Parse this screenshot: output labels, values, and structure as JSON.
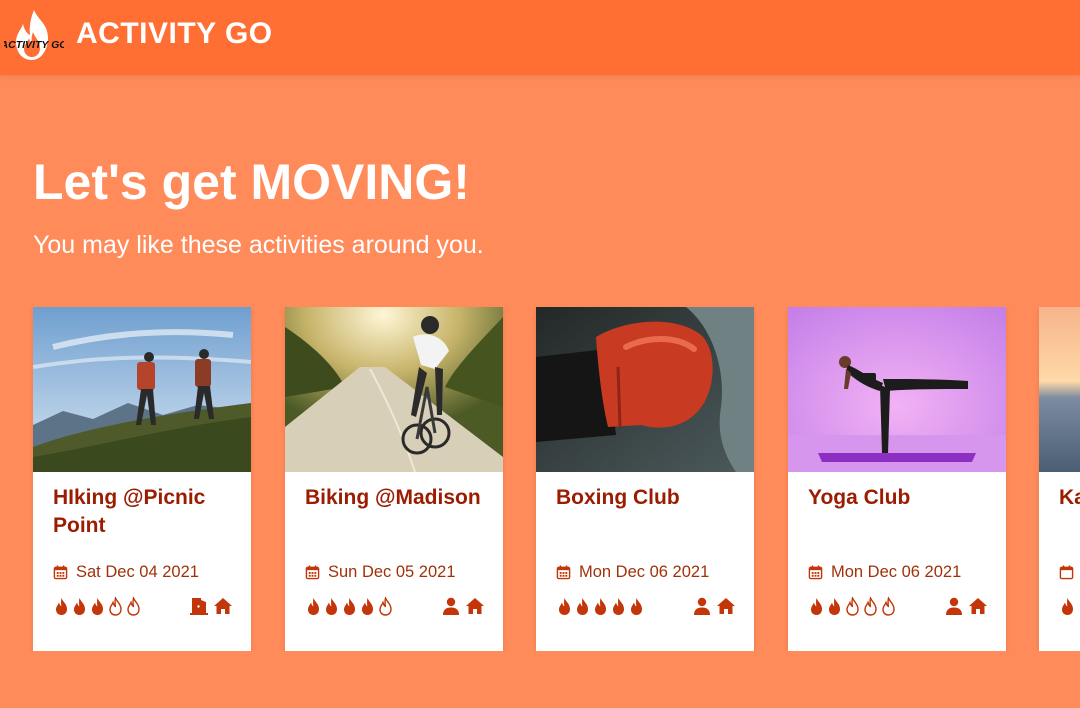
{
  "app": {
    "title": "ACTIVITY GO",
    "logo_text": "ACTIVITY GO"
  },
  "hero": {
    "title": "Let's get MOVING!",
    "subtitle": "You may like these activities around you."
  },
  "colors": {
    "header": "#ff6e33",
    "background": "#ff8a5a",
    "accent": "#c2360a",
    "title_text": "#9b1c00"
  },
  "cards": [
    {
      "title": "HIking @Picnic Point",
      "date": "Sat Dec 04 2021",
      "intensity": 3,
      "intensity_max": 5,
      "icons": [
        "door-icon",
        "home-icon"
      ],
      "image": "hiking-photo"
    },
    {
      "title": "Biking @Madison",
      "date": "Sun Dec 05 2021",
      "intensity": 4,
      "intensity_max": 5,
      "icons": [
        "person-icon",
        "home-icon"
      ],
      "image": "biking-photo"
    },
    {
      "title": "Boxing Club",
      "date": "Mon Dec 06 2021",
      "intensity": 5,
      "intensity_max": 5,
      "icons": [
        "person-icon",
        "home-icon"
      ],
      "image": "boxing-photo"
    },
    {
      "title": "Yoga Club",
      "date": "Mon Dec 06 2021",
      "intensity": 2,
      "intensity_max": 5,
      "icons": [
        "person-icon",
        "home-icon"
      ],
      "image": "yoga-photo"
    },
    {
      "title": "Ka Mo",
      "date": "",
      "intensity": 1,
      "intensity_max": 5,
      "icons": [],
      "image": "sunset-sea-photo"
    }
  ]
}
